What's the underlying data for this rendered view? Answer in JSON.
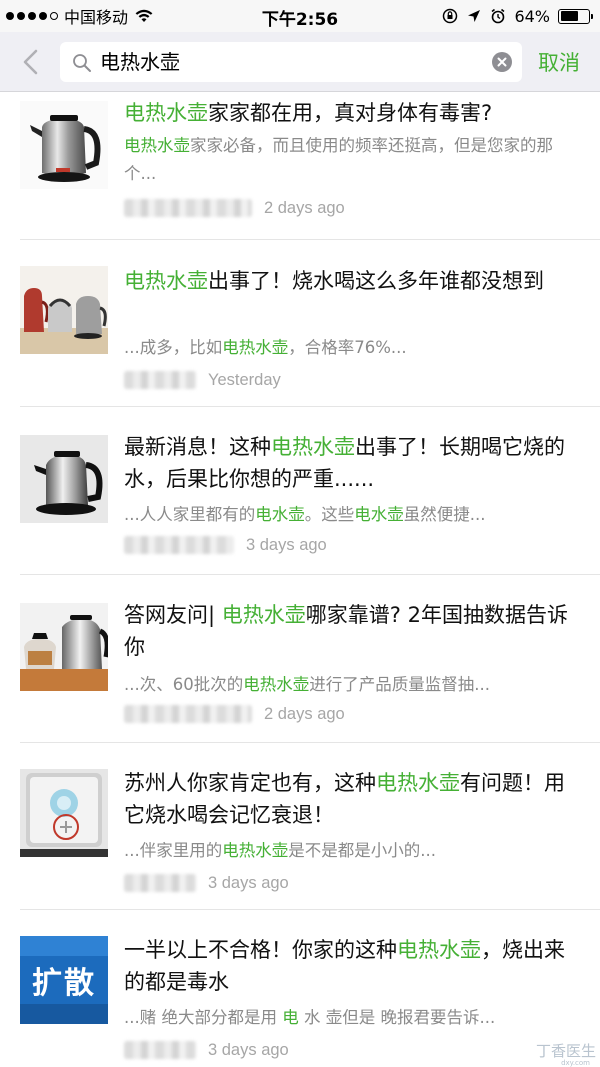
{
  "status_bar": {
    "carrier": "中国移动",
    "time": "下午2:56",
    "battery": "64%",
    "battery_level": 0.64
  },
  "search": {
    "query": "电热水壶",
    "cancel_label": "取消"
  },
  "results": [
    {
      "title": [
        [
          "电热水壶",
          true
        ],
        [
          "家家都在用，真对身体有毒害?",
          false
        ]
      ],
      "snippet": [
        [
          "电热水壶",
          true
        ],
        [
          "家家必备，而且使用的频率还挺高，但是您家的那个...",
          false
        ]
      ],
      "date": "2 days ago",
      "thumb_icon": "stainless-kettle-image"
    },
    {
      "title": [
        [
          "电热水壶",
          true
        ],
        [
          "出事了！烧水喝这么多年谁都没想到",
          false
        ]
      ],
      "snippet": [
        [
          "...成多，比如",
          false
        ],
        [
          "电热水壶",
          true
        ],
        [
          "，合格率76%...",
          false
        ]
      ],
      "date": "Yesterday",
      "thumb_icon": "kettles-group-image"
    },
    {
      "title": [
        [
          "最新消息！这种",
          false
        ],
        [
          "电热水壶",
          true
        ],
        [
          "出事了！长期喝它烧的水，后果比你想的严重......",
          false
        ]
      ],
      "snippet": [
        [
          "...人人家里都有的",
          false
        ],
        [
          "电水壶",
          true
        ],
        [
          "。这些",
          false
        ],
        [
          "电水壶",
          true
        ],
        [
          "虽然便捷...",
          false
        ]
      ],
      "date": "3 days ago",
      "thumb_icon": "kettle-on-base-image"
    },
    {
      "title": [
        [
          "答网友问| ",
          false
        ],
        [
          "电热水壶",
          true
        ],
        [
          "哪家靠谱? 2年国抽数据告诉你",
          false
        ]
      ],
      "snippet": [
        [
          "...次、60批次的",
          false
        ],
        [
          "电热水壶",
          true
        ],
        [
          "进行了产品质量监督抽...",
          false
        ]
      ],
      "date": "2 days ago",
      "thumb_icon": "kettle-and-teapot-image"
    },
    {
      "title": [
        [
          "苏州人你家肯定也有，这种",
          false
        ],
        [
          "电热水壶",
          true
        ],
        [
          "有问题！用它烧水喝会记忆衰退！",
          false
        ]
      ],
      "snippet": [
        [
          "...伴家里用的",
          false
        ],
        [
          "电热水壶",
          true
        ],
        [
          "是不是都是小小的...",
          false
        ]
      ],
      "date": "3 days ago",
      "thumb_icon": "kettle-inside-image"
    },
    {
      "title": [
        [
          "一半以上不合格！你家的这种",
          false
        ],
        [
          "电热水壶",
          true
        ],
        [
          "，烧出来的都是毒水",
          false
        ]
      ],
      "snippet": [
        [
          "...赌 绝大部分都是用 ",
          false
        ],
        [
          "电",
          true
        ],
        [
          " 水 壶但是 晚报君要告诉...",
          false
        ]
      ],
      "date": "3 days ago",
      "thumb_icon": "spread-banner-image",
      "thumb_text": "扩散"
    }
  ],
  "watermark": "丁香医生",
  "watermark_sub": "dxy.com"
}
